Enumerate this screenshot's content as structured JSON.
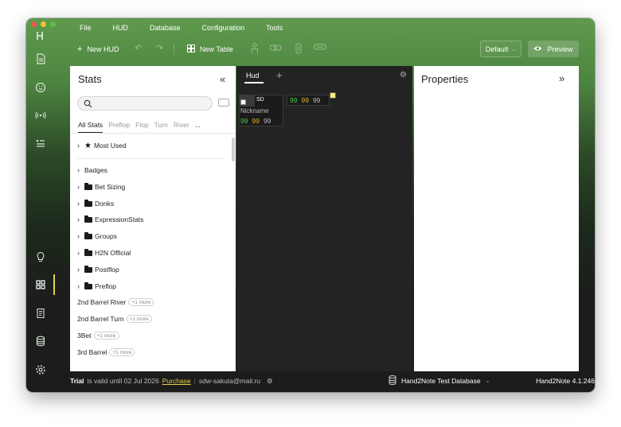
{
  "menu": [
    "File",
    "HUD",
    "Database",
    "Configuration",
    "Tools"
  ],
  "toolbar": {
    "new_hud": "New HUD",
    "new_table": "New Table",
    "layout_select": "Default",
    "preview": "Preview"
  },
  "stats": {
    "title": "Stats",
    "search_placeholder": "",
    "tabs": [
      "All Stats",
      "Preflop",
      "Flop",
      "Turn",
      "River",
      "..."
    ],
    "most_used": "Most Used",
    "folders": [
      "Badges",
      "Bet Sizing",
      "Donks",
      "ExpressionStats",
      "Groups",
      "H2N Official",
      "Postflop",
      "Preflop"
    ],
    "items": [
      {
        "label": "2nd Barrel River",
        "badge": "+1 more"
      },
      {
        "label": "2nd Barrel Turn",
        "badge": "+1 more"
      },
      {
        "label": "3Bet",
        "badge": "+1 more"
      },
      {
        "label": "3rd Barrel",
        "badge": "+1 more"
      }
    ]
  },
  "hud": {
    "tab": "Hud",
    "add": "+",
    "box1": {
      "label": "SD",
      "nickname": "Nickname",
      "values": [
        "99",
        "99",
        "99"
      ]
    },
    "box2": {
      "values": [
        "99",
        "99",
        "99"
      ]
    },
    "colors": {
      "green": "#46c746",
      "yellow": "#e0b32b",
      "gray": "#bbbbbb"
    }
  },
  "properties": {
    "title": "Properties"
  },
  "status": {
    "trial": "Trial",
    "valid_text": "is valid until 02 Jul 2026",
    "purchase": "Purchase",
    "email": "sdw-sakuta@mail.ru",
    "database": "Hand2Note Test Database",
    "version": "Hand2Note 4.1.246"
  },
  "icons": {
    "logo": "h2n-logo-icon",
    "document": "document-icon",
    "smile": "face-icon",
    "broadcast": "broadcast-icon",
    "list": "list-icon",
    "bulb": "bulb-icon",
    "grid": "grid-icon",
    "report": "report-icon",
    "database": "database-icon",
    "settings": "gear-icon"
  }
}
